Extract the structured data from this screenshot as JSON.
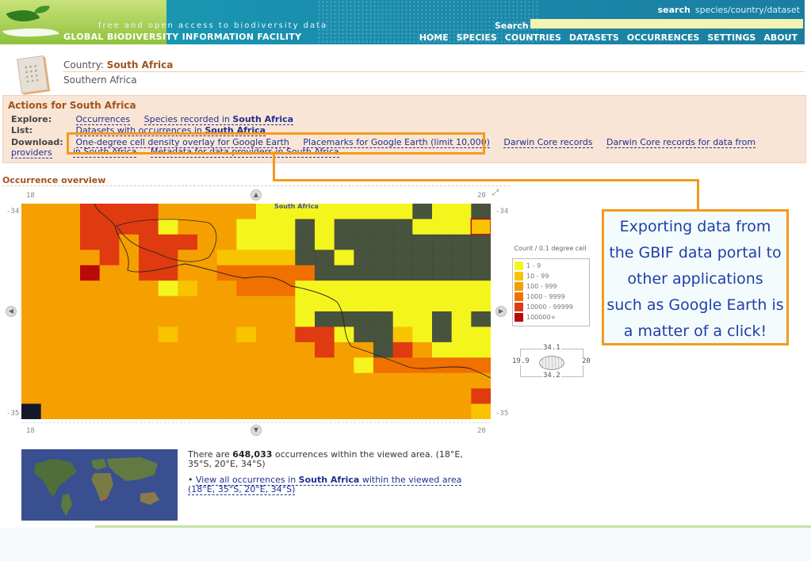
{
  "header": {
    "tagline": "free and open access to biodiversity data",
    "brand_left": "GLOBAL BIODIVERSITY",
    "brand_right": "INFORMATION FACILITY",
    "search_hint_bold": "search",
    "search_hint": "species/country/dataset",
    "search_label": "Search",
    "search_value": "",
    "nav": [
      "HOME",
      "SPECIES",
      "COUNTRIES",
      "DATASETS",
      "OCCURRENCES",
      "SETTINGS",
      "ABOUT"
    ]
  },
  "country": {
    "label": "Country:",
    "name": "South Africa",
    "region": "Southern Africa"
  },
  "actions": {
    "title": "Actions for South Africa",
    "explore_key": "Explore:",
    "explore_links": [
      "Occurrences",
      "Species recorded in"
    ],
    "explore_bold": "South Africa",
    "list_key": "List:",
    "list_text": "Datasets with occurrences in",
    "list_bold": "South Africa",
    "download_key": "Download:",
    "download_links": [
      "One-degree cell density overlay for Google Earth",
      "Placemarks for Google Earth (limit 10,000)",
      "Darwin Core records",
      "Darwin Core records for data from providers"
    ],
    "download2_a": "in South Africa",
    "download2_b": "Metadata for data providers in South Africa"
  },
  "overview": {
    "title": "Occurrence overview",
    "x_left": "18",
    "x_right": "20",
    "y_top": "-34",
    "y_bottom": "-35",
    "map_label": "South Africa",
    "legend_title": "Count / 0.1 degree cell",
    "legend": [
      {
        "label": "1 - 9",
        "color": "#f5f51e"
      },
      {
        "label": "10 - 99",
        "color": "#f8c400"
      },
      {
        "label": "100 - 999",
        "color": "#f5a000"
      },
      {
        "label": "1000 - 9999",
        "color": "#f07000"
      },
      {
        "label": "10000 - 99999",
        "color": "#e03a10"
      },
      {
        "label": "100000+",
        "color": "#b80a0a"
      }
    ],
    "bounds": {
      "north": "34.1",
      "south": "34.2",
      "west": "19.9",
      "east": "20"
    }
  },
  "callout": {
    "lines": [
      "Exporting data from",
      "the GBIF data portal to",
      "other applications",
      "such as Google Earth is",
      "a matter of a click!"
    ]
  },
  "info": {
    "prefix": "There are",
    "count": "648,033",
    "suffix": "occurrences within the viewed area. (18°E, 35°S, 20°E, 34°S)",
    "link_pre": "View all occurrences in",
    "link_bold": "South Africa",
    "link_post": "within the viewed area (18°E, 35°S, 20°E, 34°S)"
  },
  "colors": {
    "accent": "#a0521c",
    "highlight": "#f39a1d",
    "link": "#1f2f8f"
  }
}
